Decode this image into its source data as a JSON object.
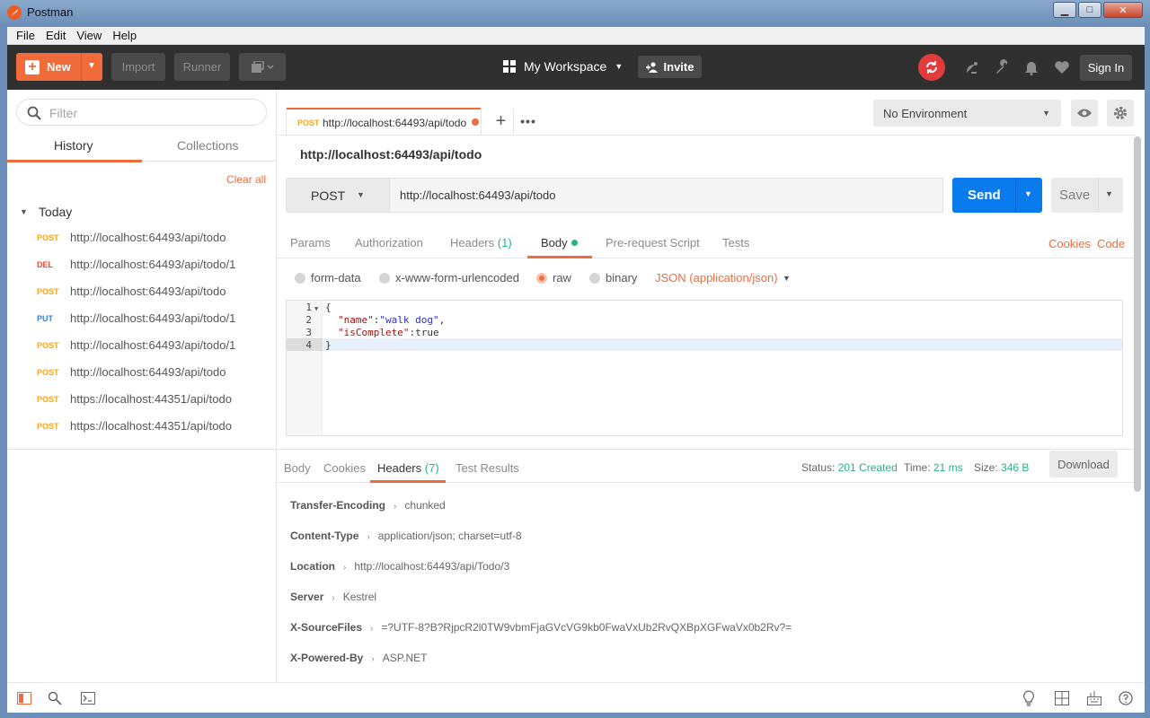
{
  "window": {
    "title": "Postman"
  },
  "menu": [
    "File",
    "Edit",
    "View",
    "Help"
  ],
  "toolbar": {
    "new_label": "New",
    "import_label": "Import",
    "runner_label": "Runner",
    "workspace_label": "My Workspace",
    "invite_label": "Invite",
    "signin_label": "Sign In"
  },
  "sidebar": {
    "filter_placeholder": "Filter",
    "tabs": [
      "History",
      "Collections"
    ],
    "clear_all": "Clear all",
    "group_label": "Today",
    "history": [
      {
        "method": "POST",
        "url": "http://localhost:64493/api/todo"
      },
      {
        "method": "DEL",
        "url": "http://localhost:64493/api/todo/1"
      },
      {
        "method": "POST",
        "url": "http://localhost:64493/api/todo"
      },
      {
        "method": "PUT",
        "url": "http://localhost:64493/api/todo/1"
      },
      {
        "method": "POST",
        "url": "http://localhost:64493/api/todo/1"
      },
      {
        "method": "POST",
        "url": "http://localhost:64493/api/todo"
      },
      {
        "method": "POST",
        "url": "https://localhost:44351/api/todo"
      },
      {
        "method": "POST",
        "url": "https://localhost:44351/api/todo"
      }
    ]
  },
  "request_tab": {
    "method": "POST",
    "url": "http://localhost:64493/api/todo"
  },
  "environment": {
    "selected": "No Environment"
  },
  "request": {
    "name": "http://localhost:64493/api/todo",
    "method": "POST",
    "url": "http://localhost:64493/api/todo",
    "send_label": "Send",
    "save_label": "Save",
    "tabs": {
      "params": "Params",
      "authorization": "Authorization",
      "headers": "Headers",
      "headers_count": "(1)",
      "body": "Body",
      "prerequest": "Pre-request Script",
      "tests": "Tests"
    },
    "cookies_link": "Cookies",
    "code_link": "Code",
    "body_modes": {
      "form_data": "form-data",
      "urlencoded": "x-www-form-urlencoded",
      "raw": "raw",
      "binary": "binary",
      "content_type": "JSON (application/json)"
    },
    "body_lines": [
      {
        "num": "1",
        "text": "{"
      },
      {
        "num": "2",
        "key": "\"name\"",
        "sep": ":",
        "val": "\"walk dog\"",
        "tail": ","
      },
      {
        "num": "3",
        "key": "\"isComplete\"",
        "sep": ":",
        "val": "true",
        "tail": ""
      },
      {
        "num": "4",
        "text": "}"
      }
    ]
  },
  "response": {
    "tabs": {
      "body": "Body",
      "cookies": "Cookies",
      "headers": "Headers",
      "headers_count": "(7)",
      "test_results": "Test Results"
    },
    "status_label": "Status:",
    "status_value": "201 Created",
    "time_label": "Time:",
    "time_value": "21 ms",
    "size_label": "Size:",
    "size_value": "346 B",
    "download_label": "Download",
    "headers": [
      {
        "key": "Transfer-Encoding",
        "value": "chunked"
      },
      {
        "key": "Content-Type",
        "value": "application/json; charset=utf-8"
      },
      {
        "key": "Location",
        "value": "http://localhost:64493/api/Todo/3"
      },
      {
        "key": "Server",
        "value": "Kestrel"
      },
      {
        "key": "X-SourceFiles",
        "value": "=?UTF-8?B?RjpcR2l0TW9vbmFjaGVcVG9kb0FwaVxUb2RvQXBpXGFwaVx0b2Rv?="
      },
      {
        "key": "X-Powered-By",
        "value": "ASP.NET"
      }
    ]
  },
  "colors": {
    "accent": "#f26b3a",
    "send": "#097bed",
    "success": "#26b47f"
  }
}
